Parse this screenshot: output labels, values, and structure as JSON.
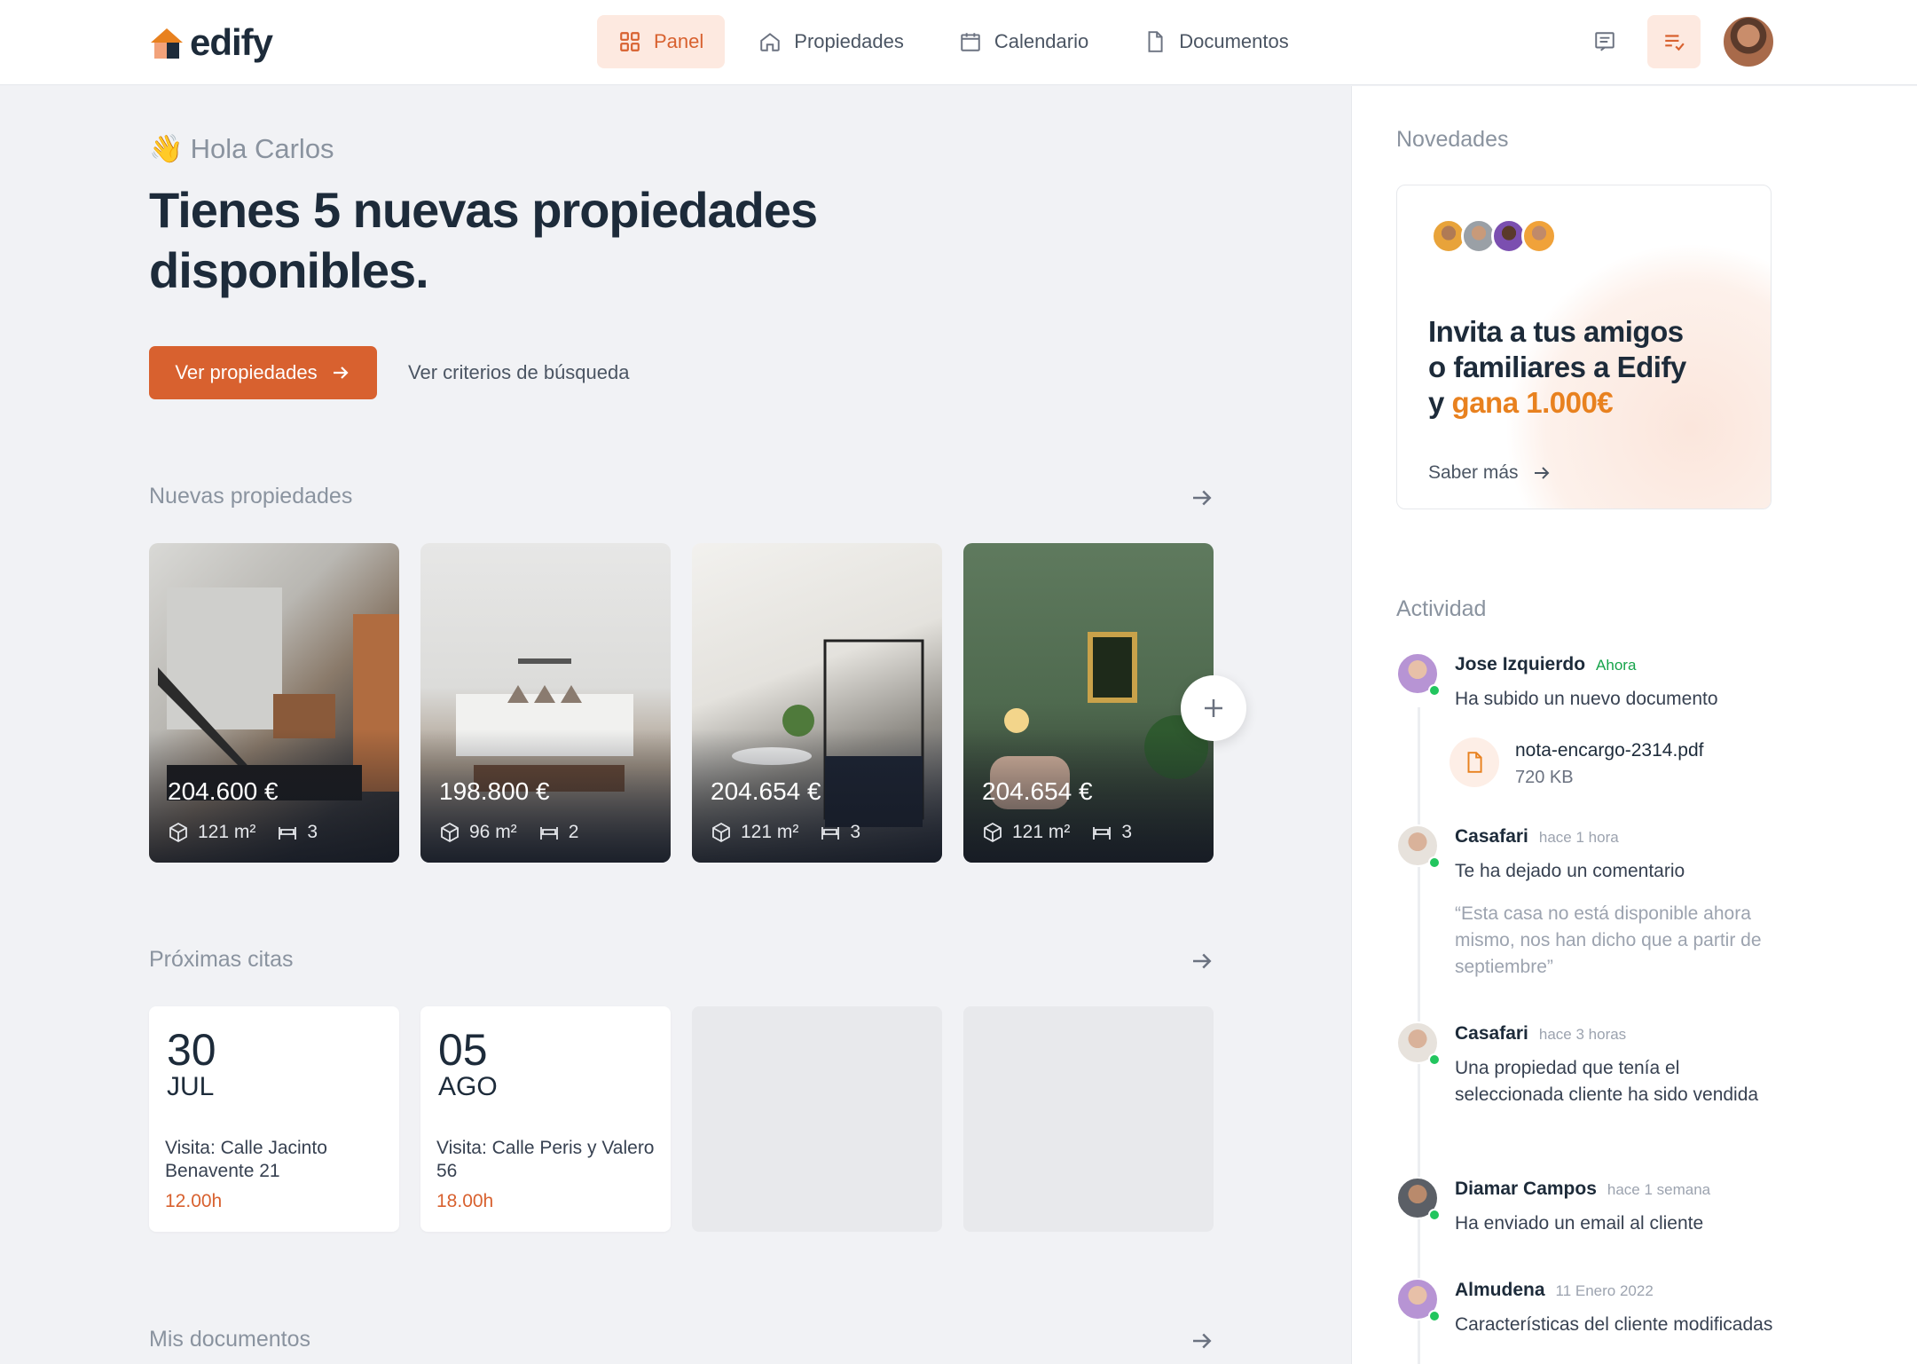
{
  "brand": {
    "name": "edify",
    "accent": "#d8612f",
    "highlight": "#e8811f"
  },
  "nav": [
    {
      "label": "Panel",
      "icon": "grid-icon",
      "active": true
    },
    {
      "label": "Propiedades",
      "icon": "home-icon",
      "active": false
    },
    {
      "label": "Calendario",
      "icon": "calendar-icon",
      "active": false
    },
    {
      "label": "Documentos",
      "icon": "document-icon",
      "active": false
    }
  ],
  "header_icons": [
    "chat-icon",
    "task-list-icon",
    "user-avatar"
  ],
  "hero": {
    "greeting": "Hola Carlos",
    "headline": "Tienes 5 nuevas propiedades disponibles.",
    "cta_label": "Ver propiedades",
    "secondary_link": "Ver criterios de búsqueda"
  },
  "sections": {
    "new_properties": "Nuevas propiedades",
    "appointments": "Próximas citas",
    "documents": "Mis documentos"
  },
  "properties": [
    {
      "price": "204.600 €",
      "area": "121 m²",
      "beds": "3"
    },
    {
      "price": "198.800 €",
      "area": "96 m²",
      "beds": "2"
    },
    {
      "price": "204.654 €",
      "area": "121 m²",
      "beds": "3"
    },
    {
      "price": "204.654 €",
      "area": "121 m²",
      "beds": "3"
    }
  ],
  "appointments": [
    {
      "day": "30",
      "month": "JUL",
      "visit": "Visita: Calle Jacinto Benavente 21",
      "time": "12.00h"
    },
    {
      "day": "05",
      "month": "AGO",
      "visit": "Visita: Calle Peris y Valero 56",
      "time": "18.00h"
    }
  ],
  "sidebar": {
    "news_title": "Novedades",
    "invite": {
      "line1": "Invita a tus amigos",
      "line2": "o familiares a Edify",
      "line3_pre": "y ",
      "line3_highlight": "gana 1.000€",
      "link": "Saber más"
    },
    "activity_title": "Actividad",
    "activity": [
      {
        "name": "Jose Izquierdo",
        "when": "Ahora",
        "desc": "Ha subido un nuevo documento",
        "file_name": "nota-encargo-2314.pdf",
        "file_size": "720 KB"
      },
      {
        "name": "Casafari",
        "when": "hace 1 hora",
        "desc": "Te ha dejado un comentario",
        "quote": "“Esta casa no está disponible ahora mismo, nos han dicho que a partir de septiembre”"
      },
      {
        "name": "Casafari",
        "when": "hace 3 horas",
        "desc": "Una propiedad que tenía el seleccionada cliente ha sido vendida"
      },
      {
        "name": "Diamar Campos",
        "when": "hace 1 semana",
        "desc": "Ha enviado un email al cliente"
      },
      {
        "name": "Almudena",
        "when": "11 Enero 2022",
        "desc": "Características del cliente modificadas"
      }
    ]
  }
}
